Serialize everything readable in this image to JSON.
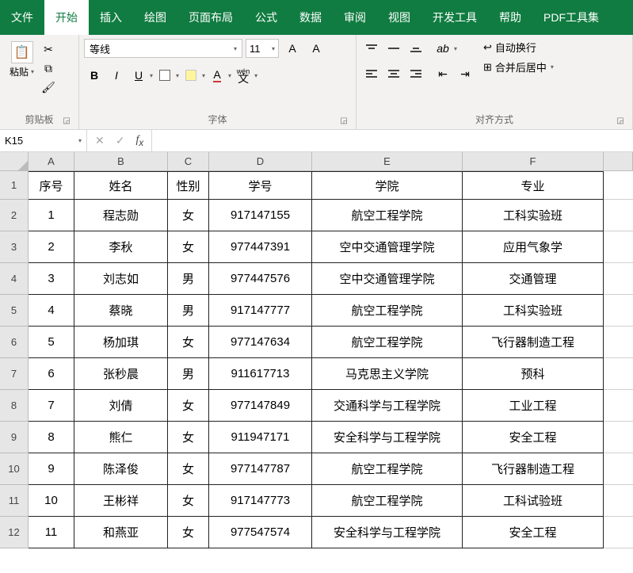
{
  "tabs": [
    "文件",
    "开始",
    "插入",
    "绘图",
    "页面布局",
    "公式",
    "数据",
    "审阅",
    "视图",
    "开发工具",
    "帮助",
    "PDF工具集"
  ],
  "activeTab": 1,
  "clipboard": {
    "paste": "粘贴",
    "label": "剪贴板"
  },
  "font": {
    "name": "等线",
    "size": "11",
    "label": "字体",
    "wen": "wén"
  },
  "align": {
    "wrap": "自动换行",
    "merge": "合并后居中",
    "label": "对齐方式"
  },
  "nameBox": "K15",
  "formula": "",
  "colHeaders": [
    "A",
    "B",
    "C",
    "D",
    "E",
    "F"
  ],
  "rowNums": [
    "1",
    "2",
    "3",
    "4",
    "5",
    "6",
    "7",
    "8",
    "9",
    "10",
    "11",
    "12"
  ],
  "headers": [
    "序号",
    "姓名",
    "性别",
    "学号",
    "学院",
    "专业"
  ],
  "rows": [
    [
      "1",
      "程志勋",
      "女",
      "917147155",
      "航空工程学院",
      "工科实验班"
    ],
    [
      "2",
      "李秋",
      "女",
      "977447391",
      "空中交通管理学院",
      "应用气象学"
    ],
    [
      "3",
      "刘志如",
      "男",
      "977447576",
      "空中交通管理学院",
      "交通管理"
    ],
    [
      "4",
      "蔡晓",
      "男",
      "917147777",
      "航空工程学院",
      "工科实验班"
    ],
    [
      "5",
      "杨加琪",
      "女",
      "977147634",
      "航空工程学院",
      "飞行器制造工程"
    ],
    [
      "6",
      "张秒晨",
      "男",
      "911617713",
      "马克思主义学院",
      "预科"
    ],
    [
      "7",
      "刘倩",
      "女",
      "977147849",
      "交通科学与工程学院",
      "工业工程"
    ],
    [
      "8",
      "熊仁",
      "女",
      "911947171",
      "安全科学与工程学院",
      "安全工程"
    ],
    [
      "9",
      "陈泽俊",
      "女",
      "977147787",
      "航空工程学院",
      "飞行器制造工程"
    ],
    [
      "10",
      "王彬祥",
      "女",
      "917147773",
      "航空工程学院",
      "工科试验班"
    ],
    [
      "11",
      "和燕亚",
      "女",
      "977547574",
      "安全科学与工程学院",
      "安全工程"
    ]
  ],
  "icons": {
    "dd": "▾",
    "chk": "✓",
    "x": "✕",
    "abc": "ab"
  }
}
